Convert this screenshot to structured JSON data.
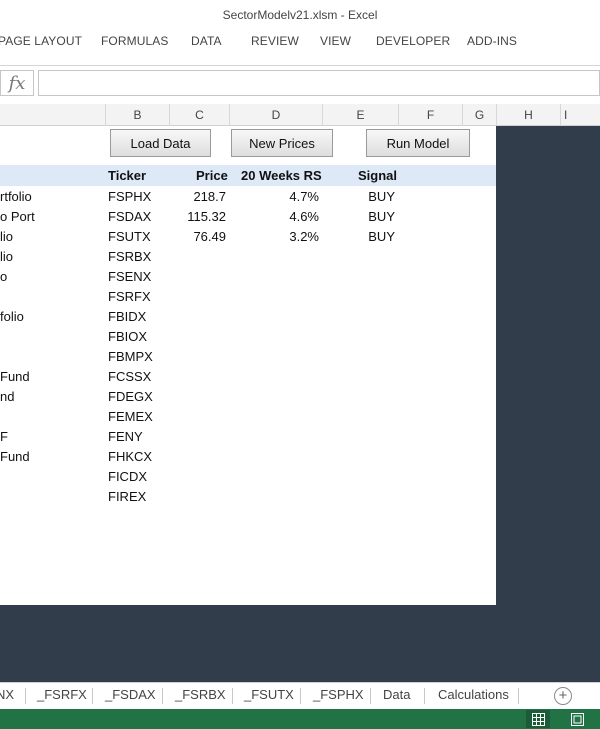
{
  "window": {
    "title": "SectorModelv21.xlsm - Excel"
  },
  "ribbon_tabs": [
    "PAGE LAYOUT",
    "FORMULAS",
    "DATA",
    "REVIEW",
    "VIEW",
    "DEVELOPER",
    "ADD-INS"
  ],
  "formula_bar": {
    "fx_label": "fx",
    "value": ""
  },
  "column_headers": [
    "B",
    "C",
    "D",
    "E",
    "F",
    "G",
    "H",
    "I"
  ],
  "buttons": {
    "load_data": "Load Data",
    "new_prices": "New Prices",
    "run_model": "Run Model"
  },
  "table": {
    "headers": {
      "ticker": "Ticker",
      "price": "Price",
      "rs": "20 Weeks RS",
      "signal": "Signal"
    },
    "name_fragments": [
      "rtfolio",
      "o Port",
      "lio",
      "lio",
      "o",
      "",
      "folio",
      "",
      "",
      "Fund",
      "nd",
      "",
      "F",
      "Fund",
      "",
      ""
    ],
    "rows": [
      {
        "ticker": "FSPHX",
        "price": "218.7",
        "rs": "4.7%",
        "signal": "BUY"
      },
      {
        "ticker": "FSDAX",
        "price": "115.32",
        "rs": "4.6%",
        "signal": "BUY"
      },
      {
        "ticker": "FSUTX",
        "price": "76.49",
        "rs": "3.2%",
        "signal": "BUY"
      },
      {
        "ticker": "FSRBX",
        "price": "",
        "rs": "",
        "signal": ""
      },
      {
        "ticker": "FSENX",
        "price": "",
        "rs": "",
        "signal": ""
      },
      {
        "ticker": "FSRFX",
        "price": "",
        "rs": "",
        "signal": ""
      },
      {
        "ticker": "FBIDX",
        "price": "",
        "rs": "",
        "signal": ""
      },
      {
        "ticker": "FBIOX",
        "price": "",
        "rs": "",
        "signal": ""
      },
      {
        "ticker": "FBMPX",
        "price": "",
        "rs": "",
        "signal": ""
      },
      {
        "ticker": "FCSSX",
        "price": "",
        "rs": "",
        "signal": ""
      },
      {
        "ticker": "FDEGX",
        "price": "",
        "rs": "",
        "signal": ""
      },
      {
        "ticker": "FEMEX",
        "price": "",
        "rs": "",
        "signal": ""
      },
      {
        "ticker": "FENY",
        "price": "",
        "rs": "",
        "signal": ""
      },
      {
        "ticker": "FHKCX",
        "price": "",
        "rs": "",
        "signal": ""
      },
      {
        "ticker": "FICDX",
        "price": "",
        "rs": "",
        "signal": ""
      },
      {
        "ticker": "FIREX",
        "price": "",
        "rs": "",
        "signal": ""
      }
    ]
  },
  "sheet_tabs": [
    "NX",
    "_FSRFX",
    "_FSDAX",
    "_FSRBX",
    "_FSUTX",
    "_FSPHX",
    "Data",
    "Calculations"
  ],
  "add_sheet_icon": "plus-circle-icon",
  "status_bar": {
    "color": "#217346",
    "view_icons": [
      "normal-view-icon",
      "page-layout-view-icon"
    ]
  }
}
